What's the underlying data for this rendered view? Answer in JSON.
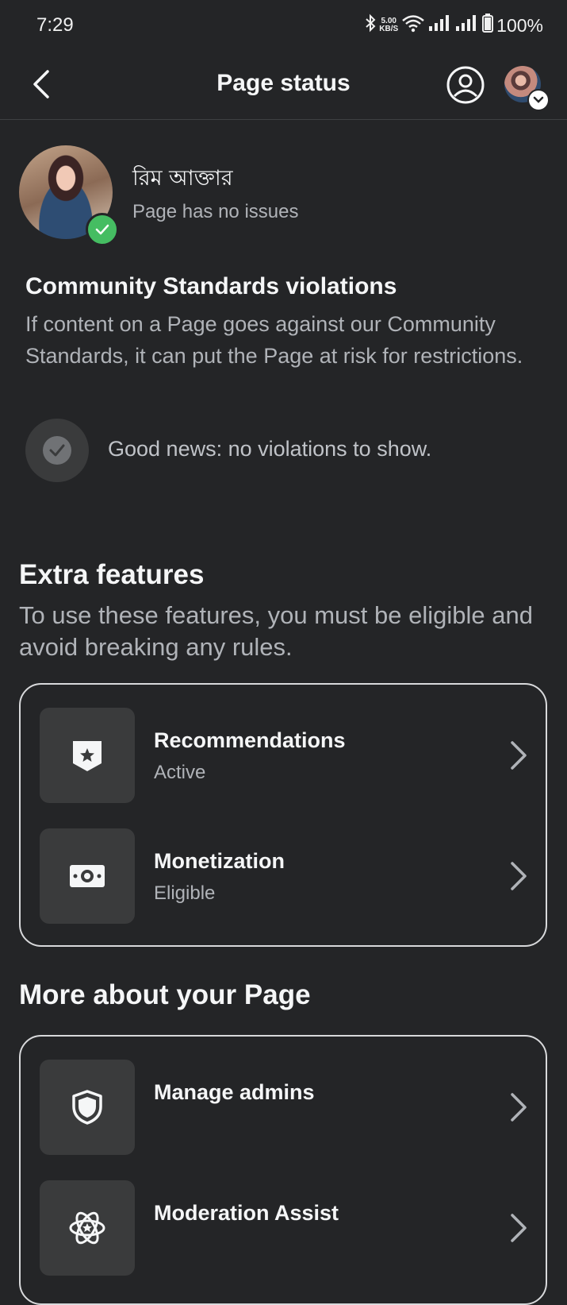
{
  "status_bar": {
    "time": "7:29",
    "speed_value": "5.00",
    "speed_unit": "KB/S",
    "battery": "100%"
  },
  "header": {
    "title": "Page status"
  },
  "profile": {
    "name": "রিম আক্তার",
    "status": "Page has no issues"
  },
  "violations": {
    "title": "Community Standards violations",
    "description": "If content on a Page goes against our Community Standards, it can put the Page at risk for restrictions.",
    "good_news": "Good news: no violations to show."
  },
  "extra_features": {
    "title": "Extra features",
    "description": "To use these features, you must be eligible and avoid breaking any rules.",
    "items": [
      {
        "label": "Recommendations",
        "status": "Active",
        "icon": "recommendations-badge-icon"
      },
      {
        "label": "Monetization",
        "status": "Eligible",
        "icon": "money-icon"
      }
    ]
  },
  "more_about": {
    "title": "More about your Page",
    "items": [
      {
        "label": "Manage admins",
        "icon": "shield-icon"
      },
      {
        "label": "Moderation Assist",
        "icon": "moderation-assist-icon"
      }
    ]
  },
  "colors": {
    "background": "#242527",
    "verified_green": "#45bd62",
    "card_border": "#d8d9db"
  }
}
